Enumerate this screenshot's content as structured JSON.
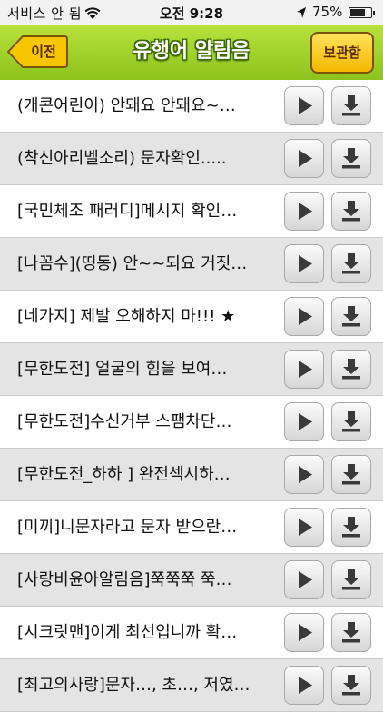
{
  "status_bar": {
    "carrier": "서비스 안 됨",
    "time": "오전 9:28",
    "battery_percent": "75%",
    "battery_level": 0.75,
    "icons": [
      "wifi-icon",
      "location-arrow-icon",
      "battery-icon"
    ]
  },
  "header": {
    "back_label": "이전",
    "title": "유행어 알림음",
    "storage_label": "보관함",
    "colors": {
      "bar": "#9acd2a",
      "back": "#f5c400",
      "storage": "#f5c400"
    }
  },
  "list": {
    "items": [
      {
        "label": "(개콘어린이) 안돼요 안돼요~…"
      },
      {
        "label": "(착신아리벨소리) 문자확인....."
      },
      {
        "label": "[국민체조 패러디]메시지 확인…"
      },
      {
        "label": "[나꼼수](띵동) 안~~되요 거짓…"
      },
      {
        "label": "[네가지] 제발 오해하지 마!!! ★"
      },
      {
        "label": "[무한도전] 얼굴의 힘을 보여…"
      },
      {
        "label": "[무한도전]수신거부 스팸차단…"
      },
      {
        "label": "[무한도전_하하 ] 완전섹시하…"
      },
      {
        "label": "[미끼]니문자라고 문자 받으란…"
      },
      {
        "label": "[사랑비윤아알림음]쭉쭉쭉 쭉…"
      },
      {
        "label": "[시크릿맨]이게 최선입니까 확…"
      },
      {
        "label": "[최고의사랑]문자…, 초…, 저였…"
      }
    ],
    "row_icons": [
      "play-icon",
      "download-icon"
    ]
  }
}
